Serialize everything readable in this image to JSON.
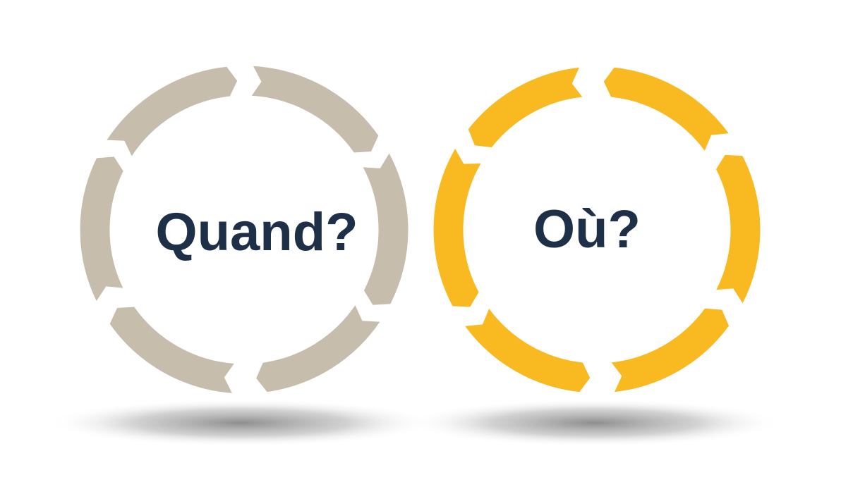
{
  "colors": {
    "background": "#ffffff",
    "ring_left": "#c6bdac",
    "ring_right": "#f8b921",
    "text": "#1e3047",
    "shadow": "#8c8c8c"
  },
  "rings": [
    {
      "id": "left",
      "label": "Quand?",
      "color": "#c6bdac",
      "segments": 6
    },
    {
      "id": "right",
      "label": "Où?",
      "color": "#f8b921",
      "segments": 6
    }
  ]
}
